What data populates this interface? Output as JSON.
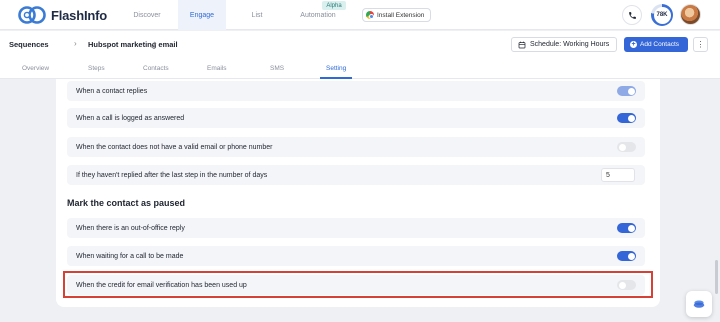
{
  "app": {
    "logo_text": "FlashInfo"
  },
  "nav": {
    "items": [
      {
        "label": "Discover"
      },
      {
        "label": "Engage"
      },
      {
        "label": "List"
      },
      {
        "label": "Automation"
      }
    ],
    "alpha_badge": "Alpha",
    "install_extension": "Install Extension",
    "score": "78K"
  },
  "breadcrumb": {
    "root": "Sequences",
    "current": "Hubspot marketing email"
  },
  "header_actions": {
    "schedule": "Schedule: Working Hours",
    "add_contacts": "Add Contacts"
  },
  "tabs": [
    {
      "label": "Overview"
    },
    {
      "label": "Steps"
    },
    {
      "label": "Contacts"
    },
    {
      "label": "Emails"
    },
    {
      "label": "SMS"
    },
    {
      "label": "Setting"
    }
  ],
  "settings": {
    "stop_rows": [
      {
        "label": "When a contact replies",
        "enabled": true
      },
      {
        "label": "When a call is logged as answered",
        "enabled": true
      },
      {
        "label": "When the contact does not have a valid email or phone number",
        "enabled": false
      },
      {
        "label": "If they haven't replied after the last step in the number of days",
        "value": "5"
      }
    ],
    "paused_title": "Mark the contact as paused",
    "paused_rows": [
      {
        "label": "When there is an out-of-office reply",
        "enabled": true
      },
      {
        "label": "When waiting for a call to be made",
        "enabled": true
      },
      {
        "label": "When the credit for email verification has been used up",
        "enabled": false
      }
    ]
  },
  "colors": {
    "accent": "#3466d8",
    "highlight": "#d64137"
  }
}
